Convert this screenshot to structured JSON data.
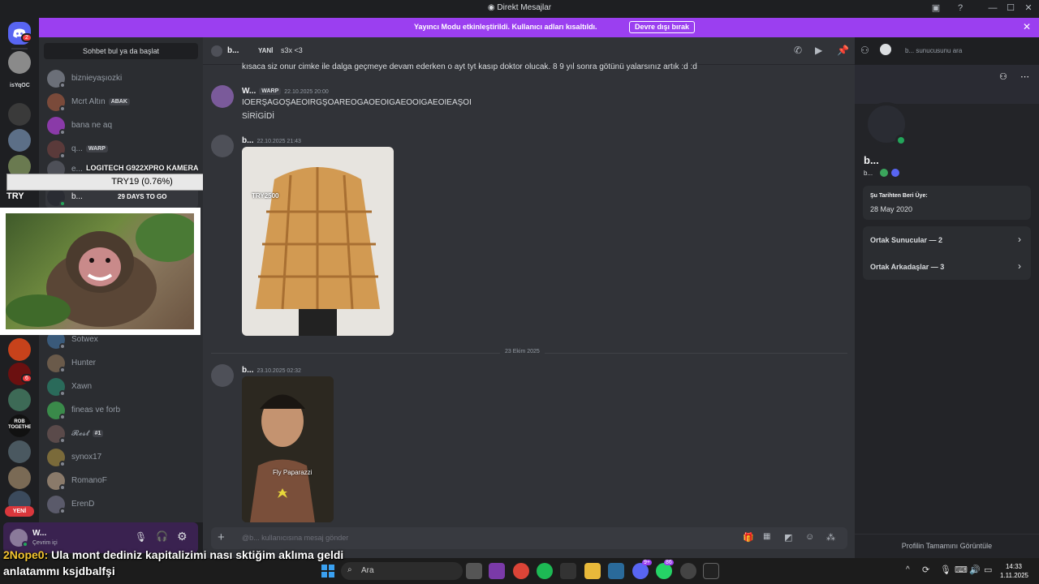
{
  "titlebar": {
    "title": "Direkt Mesajlar"
  },
  "banner": {
    "message": "Yayıncı Modu etkinleştirildi. Kullanıcı adları kısaltıldı.",
    "button": "Devre dışı bırak"
  },
  "guilds": {
    "home_badge": "2",
    "text1": "isYqOC",
    "text2": "ROB TOGETHER",
    "badge6": "6",
    "new_label": "YENİ"
  },
  "dmlist": {
    "search": "Sohbet bul ya da başlat",
    "items": [
      {
        "name": "biznieyaşıozki",
        "tag": ""
      },
      {
        "name": "Mcrt Altın",
        "tag": "ABAK"
      },
      {
        "name": "bana ne aq",
        "tag": ""
      },
      {
        "name": "q...",
        "tag": "WARP"
      },
      {
        "name": "e...",
        "tag": ""
      },
      {
        "name": "b...",
        "tag": ""
      },
      {
        "name": "Sotwex",
        "tag": ""
      },
      {
        "name": "Hunter",
        "tag": ""
      },
      {
        "name": "Xawn",
        "tag": ""
      },
      {
        "name": "fineas ve forb",
        "tag": ""
      },
      {
        "name": "𝓡𝓮𝓼𝓽",
        "tag": "#1"
      },
      {
        "name": "synox17",
        "tag": ""
      },
      {
        "name": "RomanoF",
        "tag": ""
      },
      {
        "name": "ErenD",
        "tag": ""
      }
    ]
  },
  "stock": {
    "name": "LOGITECH G922XPRO KAMERA",
    "value": "TRY19 (0.76%)",
    "days": "29 DAYS TO GO",
    "ticker": "TRY"
  },
  "userpanel": {
    "name": "W...",
    "status": "Çevrim içi"
  },
  "chat": {
    "header_name": "b...",
    "header_tag": "YANİ",
    "header_status": "s3x <3",
    "search_placeholder": "b... sunucusunu ara",
    "top_line": "kısaca siz onur cimke ile dalga geçmeye devam ederken o ayt tyt kasıp doktor olucak. 8 9 yıl sonra götünü yalarsınız artık :d :d",
    "msg1_name": "W...",
    "msg1_tag": "WARP",
    "msg1_time": "22.10.2025 20:00",
    "msg1_line1": "IOERŞAGOŞAEOIRGŞOAREOGAOEOIGAEOOIGAEOIEAŞOI",
    "msg1_line2": "SİRİGİDİ",
    "msg2_name": "b...",
    "msg2_time": "22.10.2025 21:43",
    "attach1_overlay": "TRY2500",
    "divider": "23 Ekim 2025",
    "msg3_name": "b...",
    "msg3_time": "23.10.2025 02:32",
    "attach2_caption": "Fly Paparazzi",
    "composer_placeholder": "@b... kullanıcısına mesaj gönder"
  },
  "profile": {
    "name": "b...",
    "sub": "b...",
    "member_since_label": "Şu Tarihten Beri Üye:",
    "member_since": "28 May 2020",
    "mutual_servers": "Ortak Sunucular — 2",
    "mutual_friends": "Ortak Arkadaşlar — 3",
    "view_full": "Profilin Tamamını Görüntüle"
  },
  "caption": {
    "user": "2Nope0:",
    "line1": " Ula mont dediniz kapitalizimi nası sktiğim aklıma geldi",
    "line2": "anlatammı ksjdbalfşi"
  },
  "taskbar": {
    "search": "Ara",
    "time": "14:33",
    "date": "1.11.2025",
    "discord_badge": "9+",
    "whatsapp_badge": "86"
  },
  "colors": {
    "accent": "#9b3ff0",
    "online": "#23a55a",
    "discord": "#5865f2"
  }
}
